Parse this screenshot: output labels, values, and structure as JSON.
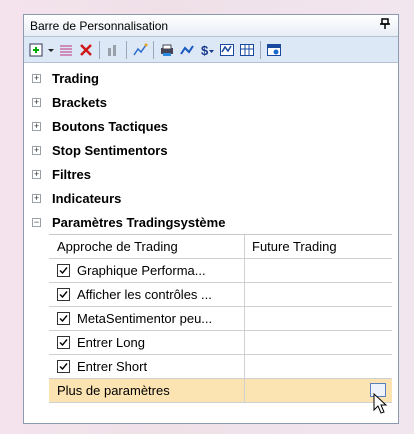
{
  "panel": {
    "title": "Barre de Personnalisation",
    "pin_glyph": "ꟷ"
  },
  "toolbar": {
    "icons": [
      "add-layout-icon",
      "dropdown-arrow-icon",
      "lines-icon",
      "delete-icon",
      "chart-icon",
      "brush-icon",
      "print-icon",
      "strategy-icon",
      "dollar-icon",
      "chart-bars-icon",
      "grid-icon",
      "calendar-icon"
    ]
  },
  "groups": [
    {
      "label": "Trading",
      "expanded": false
    },
    {
      "label": "Brackets",
      "expanded": false
    },
    {
      "label": "Boutons Tactiques",
      "expanded": false
    },
    {
      "label": "Stop Sentimentors",
      "expanded": false
    },
    {
      "label": "Filtres",
      "expanded": false
    },
    {
      "label": "Indicateurs",
      "expanded": false
    },
    {
      "label": "Paramètres Tradingsystème",
      "expanded": true
    }
  ],
  "settings": {
    "header": {
      "label": "Approche de Trading",
      "value": "Future Trading"
    },
    "rows": [
      {
        "label": "Graphique Performa...",
        "checked": true
      },
      {
        "label": "Afficher les contrôles ...",
        "checked": true
      },
      {
        "label": "MetaSentimentor peu...",
        "checked": true
      },
      {
        "label": "Entrer Long",
        "checked": true
      },
      {
        "label": "Entrer Short",
        "checked": true
      }
    ],
    "more": {
      "label": "Plus de paramètres"
    }
  },
  "colors": {
    "toolbar_bg": "#dce8f6",
    "selection_bg": "#fbe3b2"
  }
}
